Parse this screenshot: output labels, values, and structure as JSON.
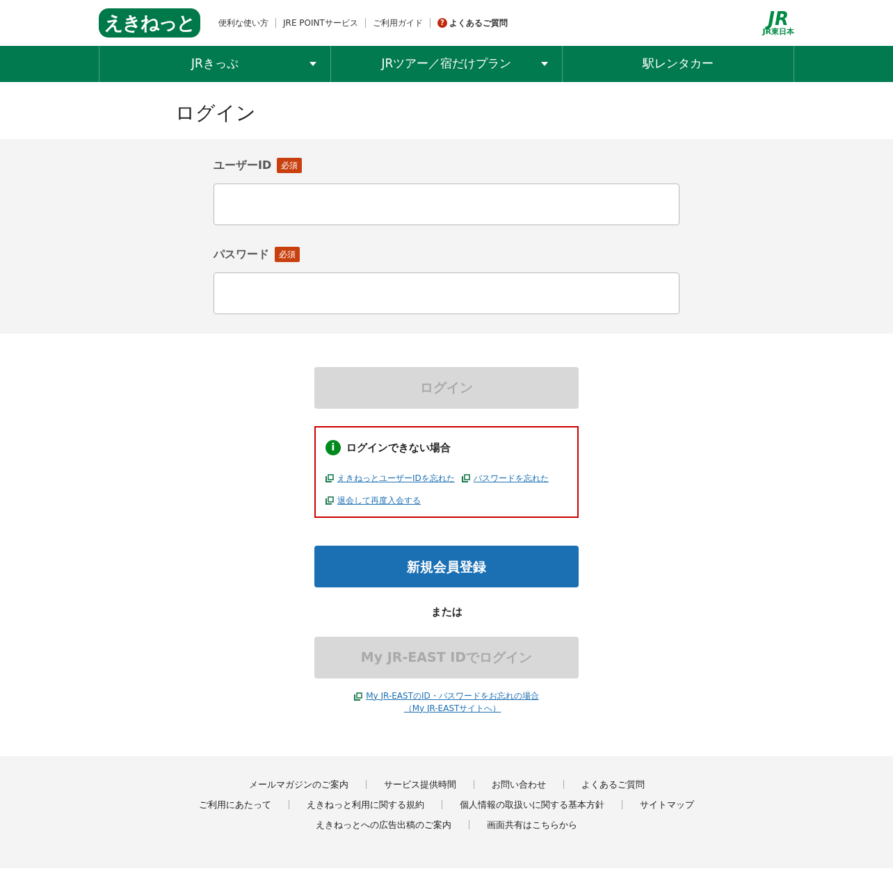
{
  "header": {
    "logo": "えきねっと",
    "links": [
      {
        "label": "便利な使い方",
        "kind": "plain"
      },
      {
        "label": "JRE POINTサービス",
        "kind": "plain"
      },
      {
        "label": "ご利用ガイド",
        "kind": "plain"
      },
      {
        "label": "よくあるご質問",
        "kind": "help",
        "icon": "?"
      }
    ],
    "brand": {
      "mark": "JR",
      "caption": "JR東日本"
    }
  },
  "nav": [
    {
      "label": "JRきっぷ",
      "dropdown": true
    },
    {
      "label": "JRツアー／宿だけプラン",
      "dropdown": true
    },
    {
      "label": "駅レンタカー",
      "dropdown": false
    }
  ],
  "page_title": "ログイン",
  "fields": [
    {
      "label": "ユーザーID",
      "required": "必須"
    },
    {
      "label": "パスワード",
      "required": "必須"
    }
  ],
  "login_button": {
    "label": "ログイン",
    "disabled": true
  },
  "help_box": {
    "icon": "i",
    "title": "ログインできない場合",
    "links": [
      "えきねっとユーザーIDを忘れた",
      "パスワードを忘れた",
      "退会して再度入会する"
    ]
  },
  "register_button": {
    "label": "新規会員登録",
    "disabled": false
  },
  "or_text": "または",
  "myjr_button": {
    "label": "My JR-EAST IDでログイン",
    "disabled": true
  },
  "myjr_link": [
    "My JR-EASTのID・パスワードをお忘れの場合",
    "（My JR-EASTサイトへ）"
  ],
  "footer": [
    [
      "メールマガジンのご案内",
      "サービス提供時間",
      "お問い合わせ",
      "よくあるご質問"
    ],
    [
      "ご利用にあたって",
      "えきねっと利用に関する規約",
      "個人情報の取扱いに関する基本方針",
      "サイトマップ"
    ],
    [
      "えきねっとへの広告出稿のご案内",
      "画面共有はこちらから"
    ]
  ]
}
